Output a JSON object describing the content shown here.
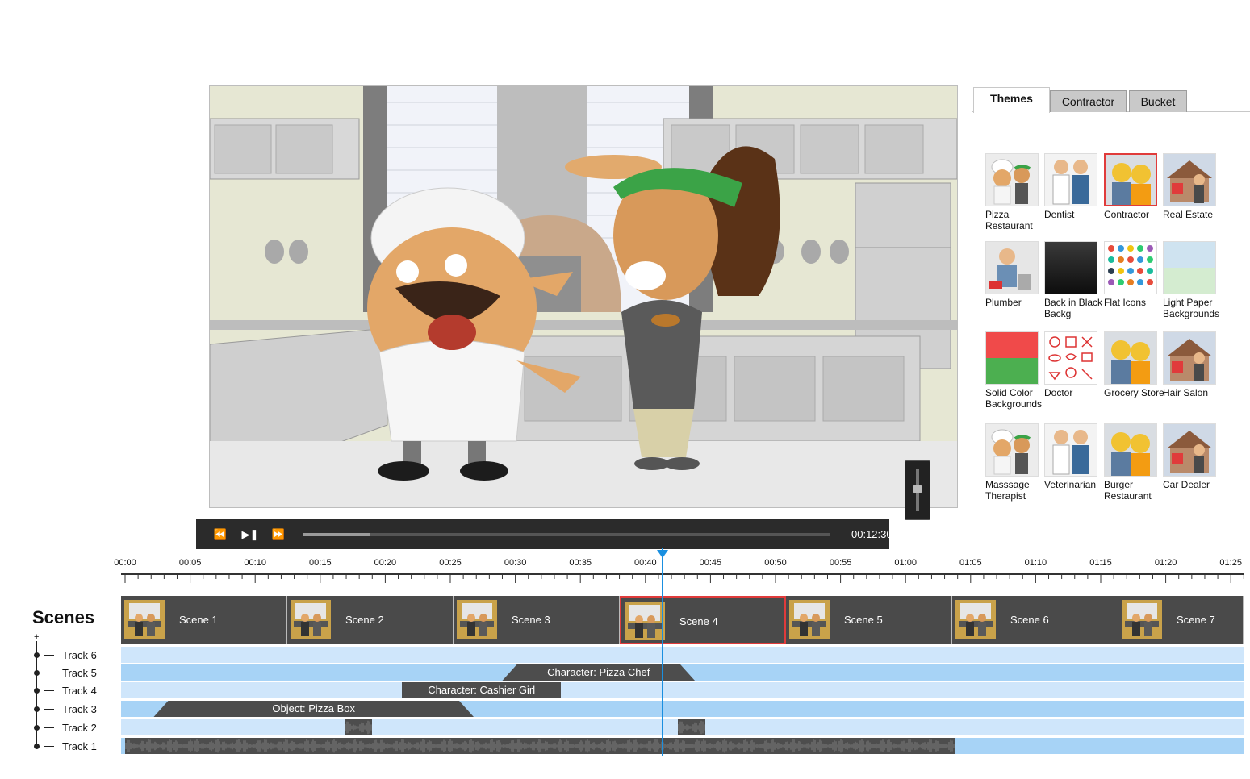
{
  "player": {
    "rewind_icon": "rewind-icon",
    "playpause_icon": "play-pause-icon",
    "forward_icon": "fast-forward-icon",
    "time": "00:12:30",
    "progress": 0.125,
    "volume_level": 0.55
  },
  "tabs": [
    {
      "label": "Themes",
      "active": true
    },
    {
      "label": "Contractor",
      "active": false
    },
    {
      "label": "Bucket",
      "active": false
    }
  ],
  "themes": [
    {
      "label": "Pizza Restaurant",
      "kind": "chef"
    },
    {
      "label": "Dentist",
      "kind": "doctor"
    },
    {
      "label": "Contractor",
      "kind": "workers",
      "selected": true
    },
    {
      "label": "Real Estate",
      "kind": "house"
    },
    {
      "label": "Plumber",
      "kind": "plumber"
    },
    {
      "label": "Back in Black Backg",
      "kind": "black"
    },
    {
      "label": "Flat Icons",
      "kind": "icons"
    },
    {
      "label": "Light Paper Backgrounds",
      "kind": "paper"
    },
    {
      "label": "Solid Color Backgrounds",
      "kind": "solid"
    },
    {
      "label": "Doctor",
      "kind": "doodle"
    },
    {
      "label": "Grocery Store",
      "kind": "workers"
    },
    {
      "label": "Hair Salon",
      "kind": "house"
    },
    {
      "label": "Masssage Therapist",
      "kind": "chef"
    },
    {
      "label": "Veterinarian",
      "kind": "doctor"
    },
    {
      "label": "Burger Restaurant",
      "kind": "workers"
    },
    {
      "label": "Car Dealer",
      "kind": "house"
    }
  ],
  "timeline": {
    "ticks": [
      "00:00",
      "00:05",
      "00:10",
      "00:15",
      "00:20",
      "00:25",
      "00:30",
      "00:35",
      "00:40",
      "00:45",
      "00:50",
      "00:55",
      "01:00",
      "01:05",
      "01:10",
      "01:15",
      "01:20",
      "01:25"
    ],
    "playhead_seconds": 41.3
  },
  "scenes_title": "Scenes",
  "scenes": [
    {
      "label": "Scene 1"
    },
    {
      "label": "Scene 2"
    },
    {
      "label": "Scene 3"
    },
    {
      "label": "Scene 4",
      "selected": true
    },
    {
      "label": "Scene 5"
    },
    {
      "label": "Scene 6"
    },
    {
      "label": "Scene 7"
    }
  ],
  "tracks": [
    {
      "label": "Track 6"
    },
    {
      "label": "Track 5"
    },
    {
      "label": "Track 4"
    },
    {
      "label": "Track 3"
    },
    {
      "label": "Track 2"
    },
    {
      "label": "Track 1"
    }
  ],
  "clips": [
    {
      "track": "Track 5",
      "label": "Character: Pizza Chef",
      "start": 29,
      "end": 43.8,
      "shape": "trap"
    },
    {
      "track": "Track 4",
      "label": "Character: Cashier Girl",
      "start": 21.3,
      "end": 33.5,
      "shape": "rect"
    },
    {
      "track": "Track 3",
      "label": "Object: Pizza Box",
      "start": 2.2,
      "end": 26.8,
      "shape": "trap"
    }
  ],
  "audio_clips": [
    {
      "track": "Track 2",
      "start": 16.9,
      "end": 19.0
    },
    {
      "track": "Track 2",
      "start": 42.5,
      "end": 44.6
    },
    {
      "track": "Track 1",
      "start": 0,
      "end": 63.8
    }
  ]
}
